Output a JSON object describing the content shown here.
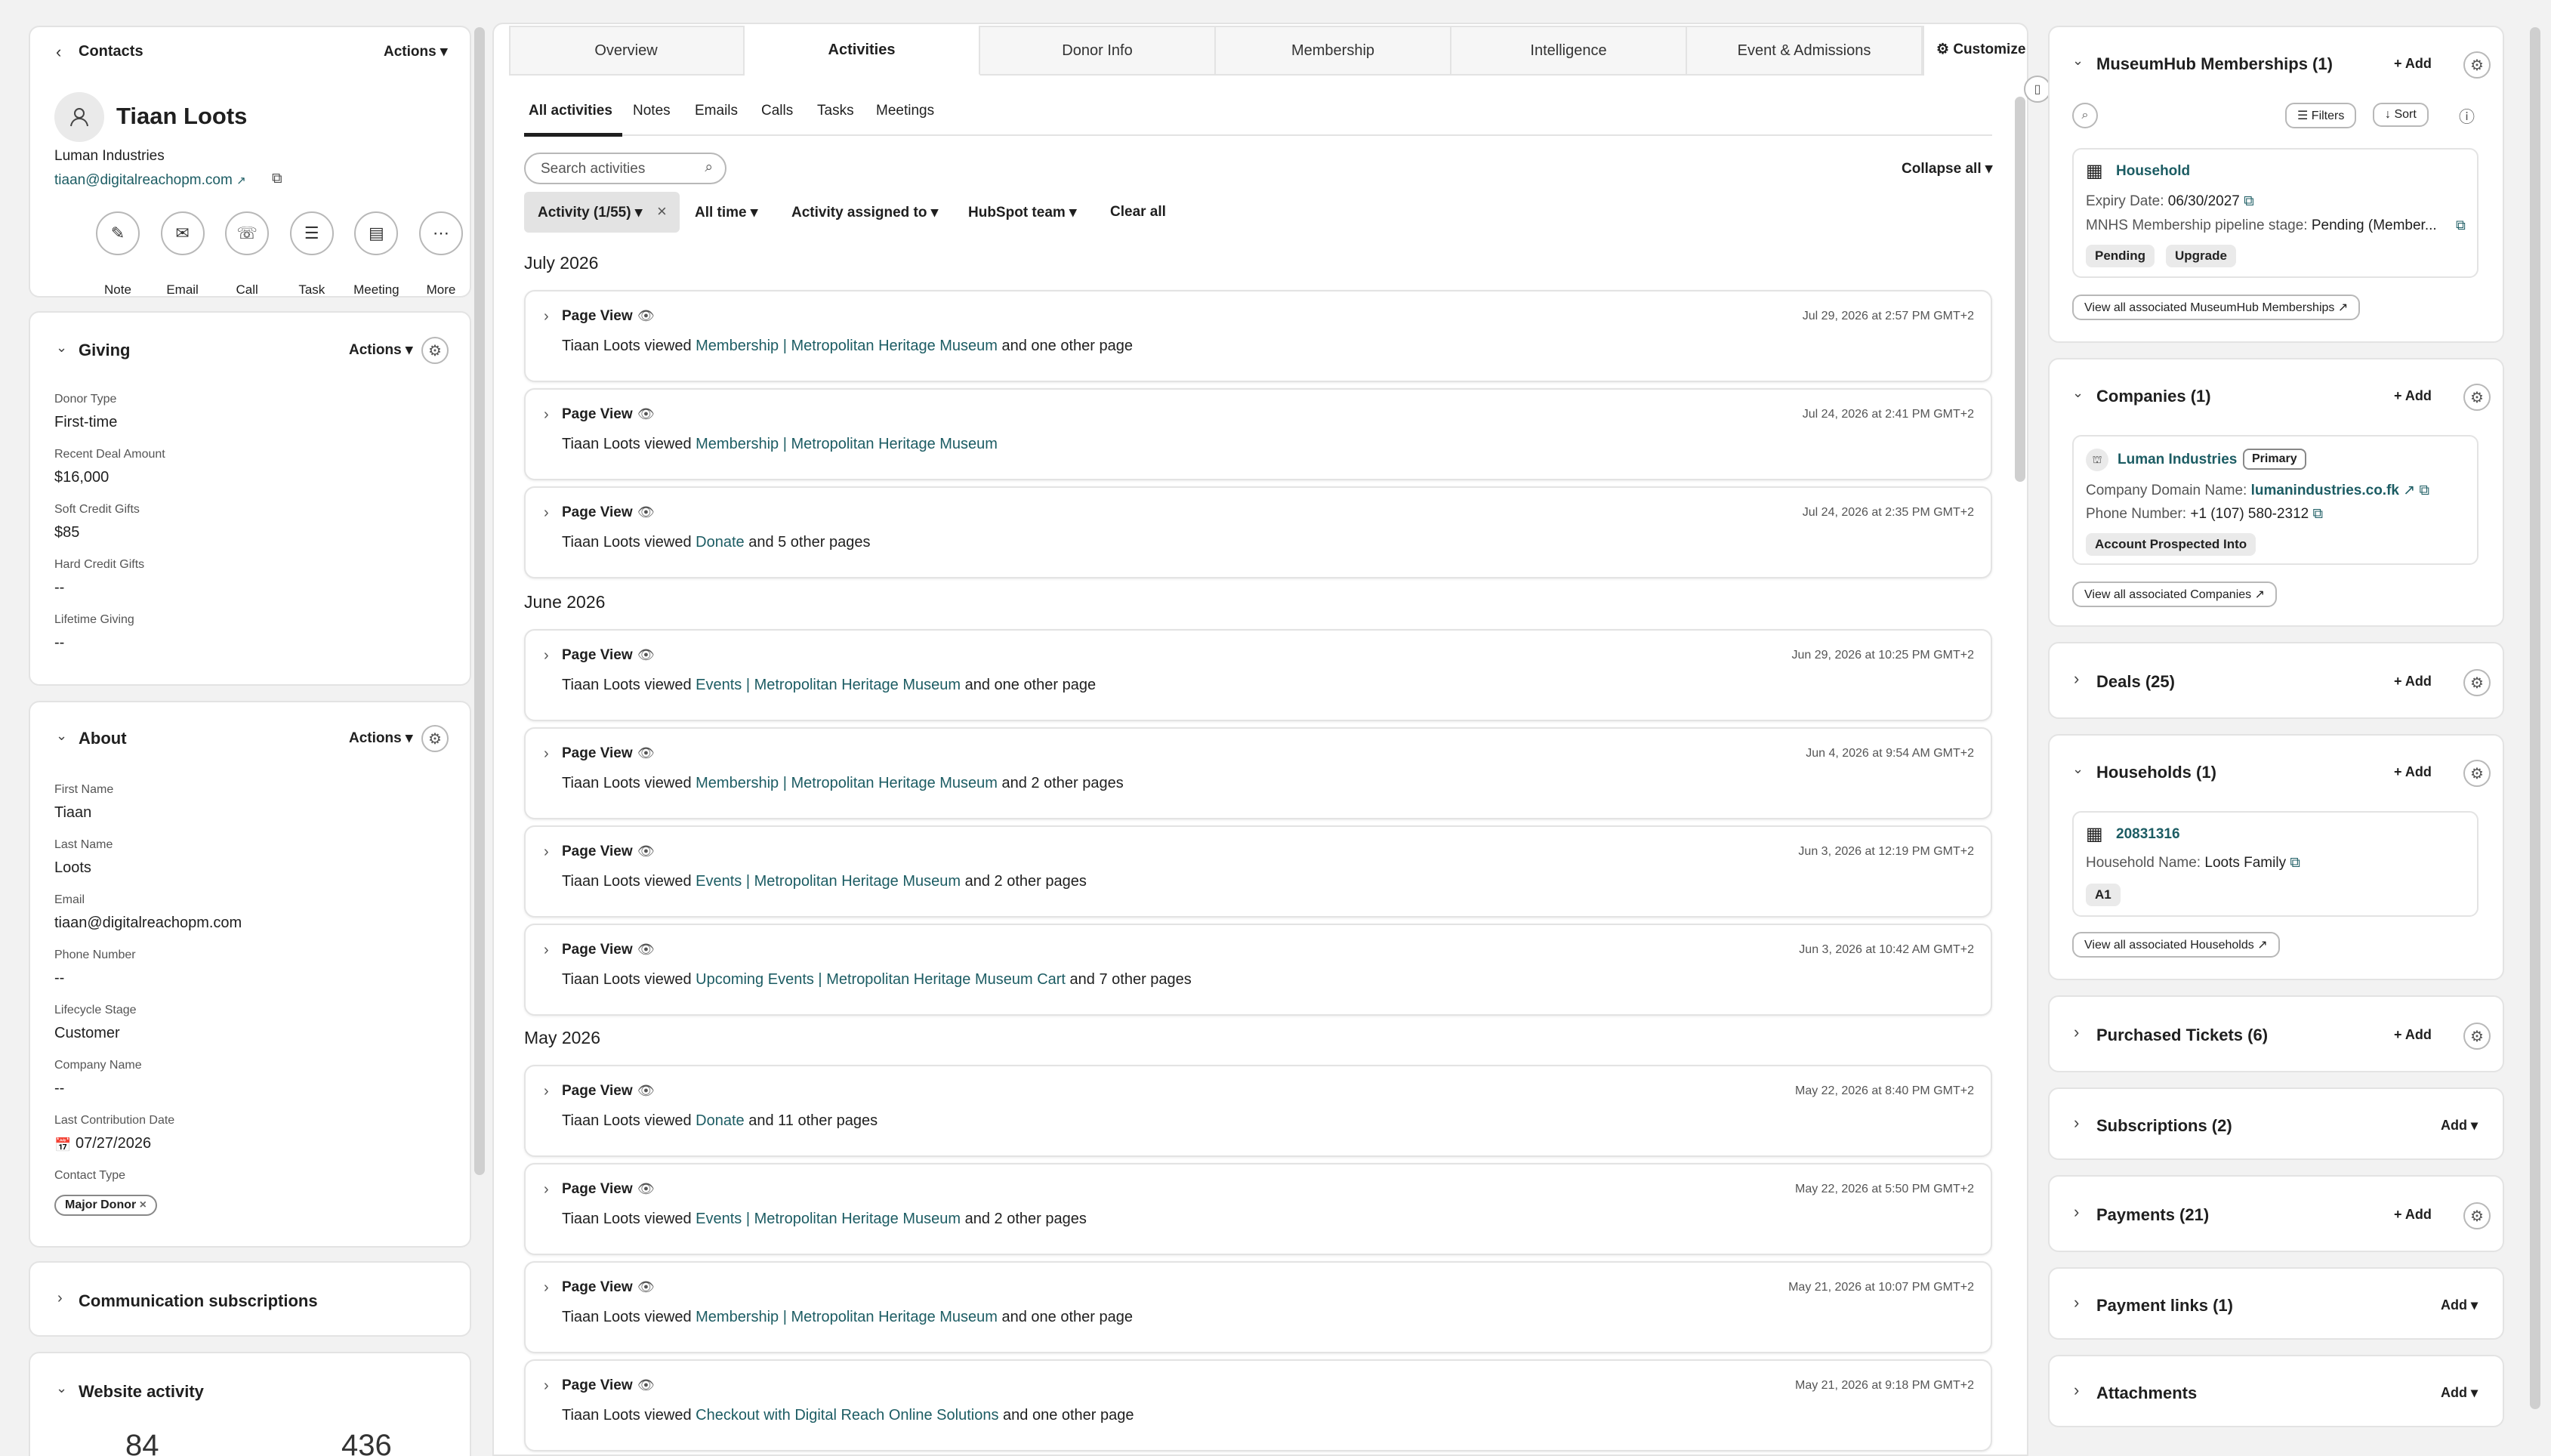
{
  "left": {
    "back_label": "Contacts",
    "actions_label": "Actions",
    "contact": {
      "name": "Tiaan Loots",
      "company": "Luman Industries",
      "email": "tiaan@digitalreachopm.com"
    },
    "quick_actions": [
      {
        "label": "Note",
        "icon": "note-icon"
      },
      {
        "label": "Email",
        "icon": "email-icon"
      },
      {
        "label": "Call",
        "icon": "call-icon"
      },
      {
        "label": "Task",
        "icon": "task-icon"
      },
      {
        "label": "Meeting",
        "icon": "meeting-icon"
      },
      {
        "label": "More",
        "icon": "more-icon"
      }
    ],
    "giving": {
      "title": "Giving",
      "actions": "Actions",
      "fields": [
        {
          "label": "Donor Type",
          "value": "First-time"
        },
        {
          "label": "Recent Deal Amount",
          "value": "$16,000"
        },
        {
          "label": "Soft Credit Gifts",
          "value": "$85"
        },
        {
          "label": "Hard Credit Gifts",
          "value": "--"
        },
        {
          "label": "Lifetime Giving",
          "value": "--"
        }
      ]
    },
    "about": {
      "title": "About",
      "actions": "Actions",
      "fields": [
        {
          "label": "First Name",
          "value": "Tiaan"
        },
        {
          "label": "Last Name",
          "value": "Loots"
        },
        {
          "label": "Email",
          "value": "tiaan@digitalreachopm.com"
        },
        {
          "label": "Phone Number",
          "value": "--"
        },
        {
          "label": "Lifecycle Stage",
          "value": "Customer"
        },
        {
          "label": "Company Name",
          "value": "--"
        },
        {
          "label": "Last Contribution Date",
          "value": "07/27/2026"
        },
        {
          "label": "Contact Type",
          "value": "Major Donor"
        }
      ]
    },
    "comm_subs": "Communication subscriptions",
    "website_activity": {
      "title": "Website activity",
      "n1": "84",
      "n2": "436"
    }
  },
  "center": {
    "top_tabs": [
      "Overview",
      "Activities",
      "Donor Info",
      "Membership",
      "Intelligence",
      "Event & Admissions"
    ],
    "customize": "Customize",
    "sub_tabs": [
      "All activities",
      "Notes",
      "Emails",
      "Calls",
      "Tasks",
      "Meetings"
    ],
    "search_placeholder": "Search activities",
    "collapse_all": "Collapse all",
    "filters": {
      "activity": "Activity (1/55)",
      "time": "All time",
      "assigned": "Activity assigned to",
      "team": "HubSpot team",
      "clear": "Clear all"
    },
    "months": [
      "July 2026",
      "June 2026",
      "May 2026"
    ],
    "activities": [
      {
        "title": "Page View",
        "time": "Jul 29, 2026 at 2:57 PM GMT+2",
        "pre": "Tiaan Loots viewed ",
        "link": "Membership | Metropolitan Heritage Museum",
        "post": " and one other page"
      },
      {
        "title": "Page View",
        "time": "Jul 24, 2026 at 2:41 PM GMT+2",
        "pre": "Tiaan Loots viewed ",
        "link": "Membership | Metropolitan Heritage Museum",
        "post": ""
      },
      {
        "title": "Page View",
        "time": "Jul 24, 2026 at 2:35 PM GMT+2",
        "pre": "Tiaan Loots viewed ",
        "link": "Donate",
        "post": " and 5 other pages"
      },
      {
        "title": "Page View",
        "time": "Jun 29, 2026 at 10:25 PM GMT+2",
        "pre": "Tiaan Loots viewed ",
        "link": "Events | Metropolitan Heritage Museum",
        "post": " and one other page"
      },
      {
        "title": "Page View",
        "time": "Jun 4, 2026 at 9:54 AM GMT+2",
        "pre": "Tiaan Loots viewed ",
        "link": "Membership | Metropolitan Heritage Museum",
        "post": " and 2 other pages"
      },
      {
        "title": "Page View",
        "time": "Jun 3, 2026 at 12:19 PM GMT+2",
        "pre": "Tiaan Loots viewed ",
        "link": "Events | Metropolitan Heritage Museum",
        "post": " and 2 other pages"
      },
      {
        "title": "Page View",
        "time": "Jun 3, 2026 at 10:42 AM GMT+2",
        "pre": "Tiaan Loots viewed ",
        "link": "Upcoming Events | Metropolitan Heritage Museum Cart",
        "post": " and 7 other pages"
      },
      {
        "title": "Page View",
        "time": "May 22, 2026 at 8:40 PM GMT+2",
        "pre": "Tiaan Loots viewed ",
        "link": "Donate",
        "post": " and 11 other pages"
      },
      {
        "title": "Page View",
        "time": "May 22, 2026 at 5:50 PM GMT+2",
        "pre": "Tiaan Loots viewed ",
        "link": "Events | Metropolitan Heritage Museum",
        "post": " and 2 other pages"
      },
      {
        "title": "Page View",
        "time": "May 21, 2026 at 10:07 PM GMT+2",
        "pre": "Tiaan Loots viewed ",
        "link": "Membership | Metropolitan Heritage Museum",
        "post": " and one other page"
      },
      {
        "title": "Page View",
        "time": "May 21, 2026 at 9:18 PM GMT+2",
        "pre": "Tiaan Loots viewed ",
        "link": "Checkout with Digital Reach Online Solutions",
        "post": " and one other page"
      }
    ]
  },
  "right": {
    "add": "Add",
    "memberships": {
      "title": "MuseumHub Memberships (1)",
      "filters": "Filters",
      "sort": "Sort",
      "record_name": "Household",
      "expiry_label": "Expiry Date:",
      "expiry_value": "06/30/2027",
      "stage_label": "MNHS Membership pipeline stage:",
      "stage_value": "Pending (Member...",
      "tags": [
        "Pending",
        "Upgrade"
      ],
      "view_all": "View all associated MuseumHub Memberships"
    },
    "companies": {
      "title": "Companies (1)",
      "name": "Luman Industries",
      "primary": "Primary",
      "domain_label": "Company Domain Name:",
      "domain_value": "lumanindustries.co.fk",
      "phone_label": "Phone Number:",
      "phone_value": "+1 (107) 580-2312",
      "tag": "Account Prospected Into",
      "view_all": "View all associated Companies"
    },
    "deals": {
      "title": "Deals (25)"
    },
    "households": {
      "title": "Households (1)",
      "id": "20831316",
      "name_label": "Household Name:",
      "name_value": "Loots Family",
      "tag": "A1",
      "view_all": "View all associated Households"
    },
    "purchased": {
      "title": "Purchased Tickets (6)"
    },
    "subscriptions": {
      "title": "Subscriptions (2)"
    },
    "payments": {
      "title": "Payments (21)"
    },
    "payment_links": {
      "title": "Payment links (1)"
    },
    "attachments": {
      "title": "Attachments"
    }
  }
}
